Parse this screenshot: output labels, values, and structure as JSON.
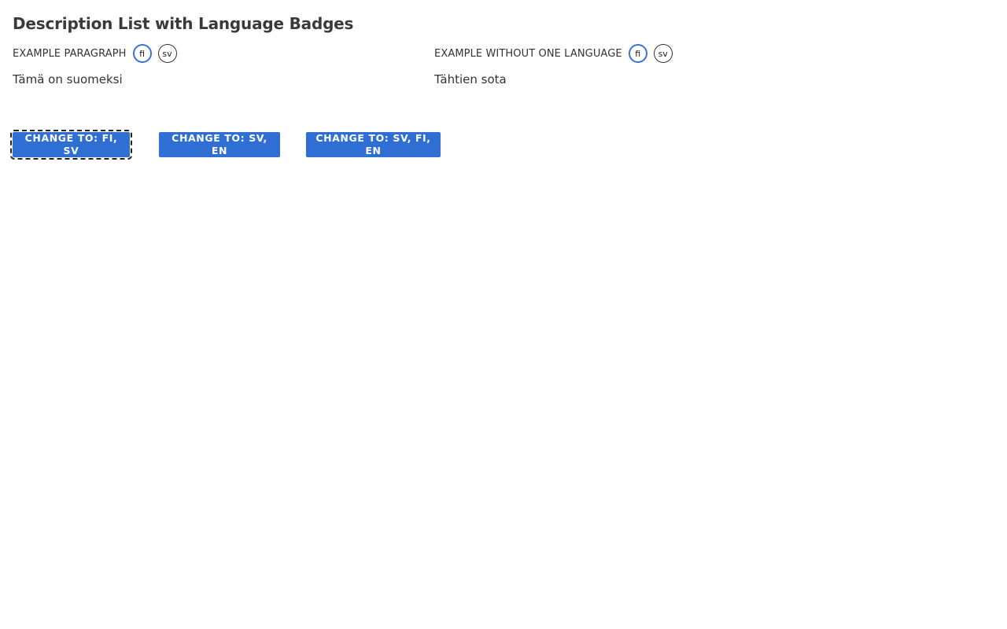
{
  "page_title": "Description List with Language Badges",
  "description_list": [
    {
      "term": "EXAMPLE PARAGRAPH",
      "badges": [
        {
          "label": "fi",
          "active": true
        },
        {
          "label": "sv",
          "active": false
        }
      ],
      "description": "Tämä on suomeksi"
    },
    {
      "term": "EXAMPLE WITHOUT ONE LANGUAGE",
      "badges": [
        {
          "label": "fi",
          "active": true
        },
        {
          "label": "sv",
          "active": false
        }
      ],
      "description": "Tähtien sota"
    }
  ],
  "buttons": [
    {
      "label": "CHANGE TO: FI, SV",
      "focused": true
    },
    {
      "label": "CHANGE TO: SV, EN",
      "focused": false
    },
    {
      "label": "CHANGE TO: SV, FI, EN",
      "focused": false
    }
  ],
  "colors": {
    "accent": "#2f6fd3",
    "active_badge_border": "#3b73d4",
    "text": "#333333",
    "background": "#ffffff"
  }
}
